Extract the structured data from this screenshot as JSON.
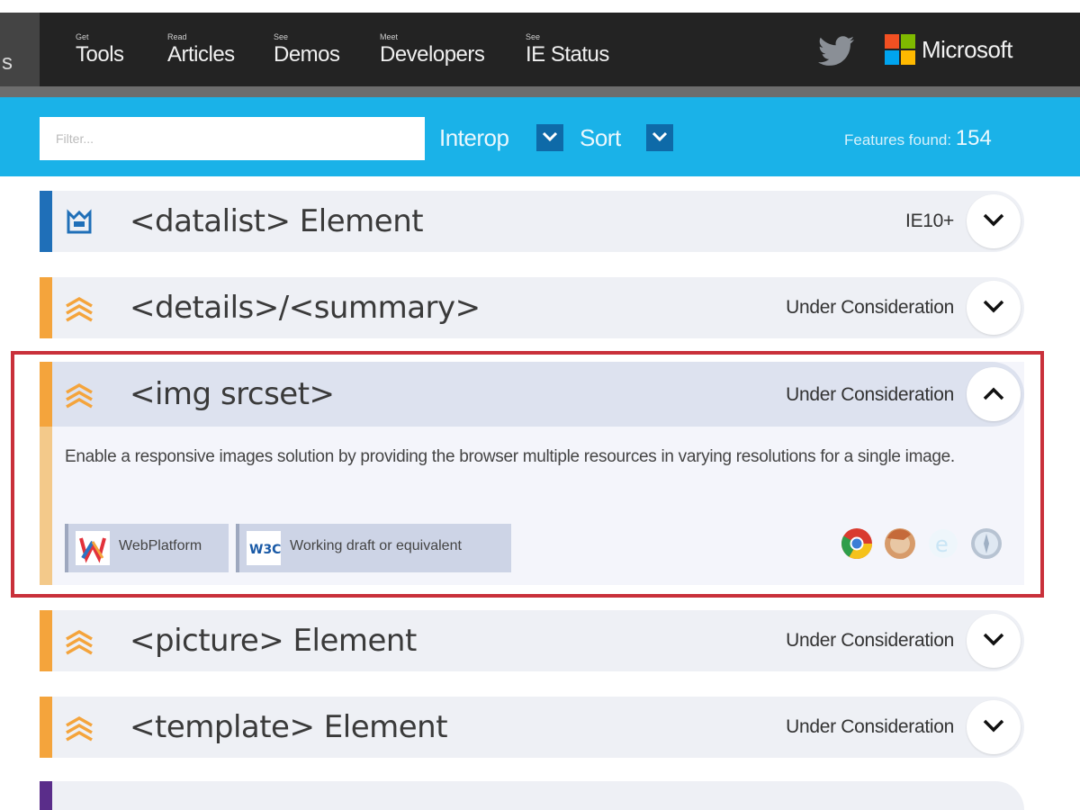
{
  "nav": {
    "stub_label": "s",
    "items": [
      {
        "small": "Get",
        "label": "Tools"
      },
      {
        "small": "Read",
        "label": "Articles"
      },
      {
        "small": "See",
        "label": "Demos"
      },
      {
        "small": "Meet",
        "label": "Developers"
      },
      {
        "small": "See",
        "label": "IE Status"
      }
    ],
    "brand": "Microsoft"
  },
  "filterbar": {
    "placeholder": "Filter...",
    "interop_label": "Interop",
    "sort_label": "Sort",
    "features_found_label": "Features found:",
    "features_found_count": "154"
  },
  "features": [
    {
      "title": "<datalist> Element",
      "status": "IE10+",
      "icon": "supported-icon",
      "accent": "#1f6fb8"
    },
    {
      "title": "<details>/<summary>",
      "status": "Under Consideration",
      "icon": "consideration-icon",
      "accent": "#f4a43c"
    },
    {
      "title": "<img srcset>",
      "status": "Under Consideration",
      "icon": "consideration-icon",
      "accent": "#f4a43c",
      "expanded": true,
      "description": "Enable a responsive images solution by providing the browser multiple resources in varying resolutions for a single image.",
      "badges": [
        {
          "label": "WebPlatform",
          "icon": "webplatform-icon"
        },
        {
          "label": "Working draft or equivalent",
          "icon": "w3c-icon"
        }
      ],
      "browsers": [
        "chrome-icon",
        "firefox-icon",
        "ie-icon",
        "safari-icon"
      ]
    },
    {
      "title": "<picture> Element",
      "status": "Under Consideration",
      "icon": "consideration-icon",
      "accent": "#f4a43c"
    },
    {
      "title": "<template> Element",
      "status": "Under Consideration",
      "icon": "consideration-icon",
      "accent": "#f4a43c"
    }
  ],
  "colors": {
    "topbar": "#232323",
    "filterbar": "#1ab2e8",
    "dropdown": "#0e6aa8",
    "row_bg": "#eef0f5",
    "highlight": "#c9303a"
  }
}
